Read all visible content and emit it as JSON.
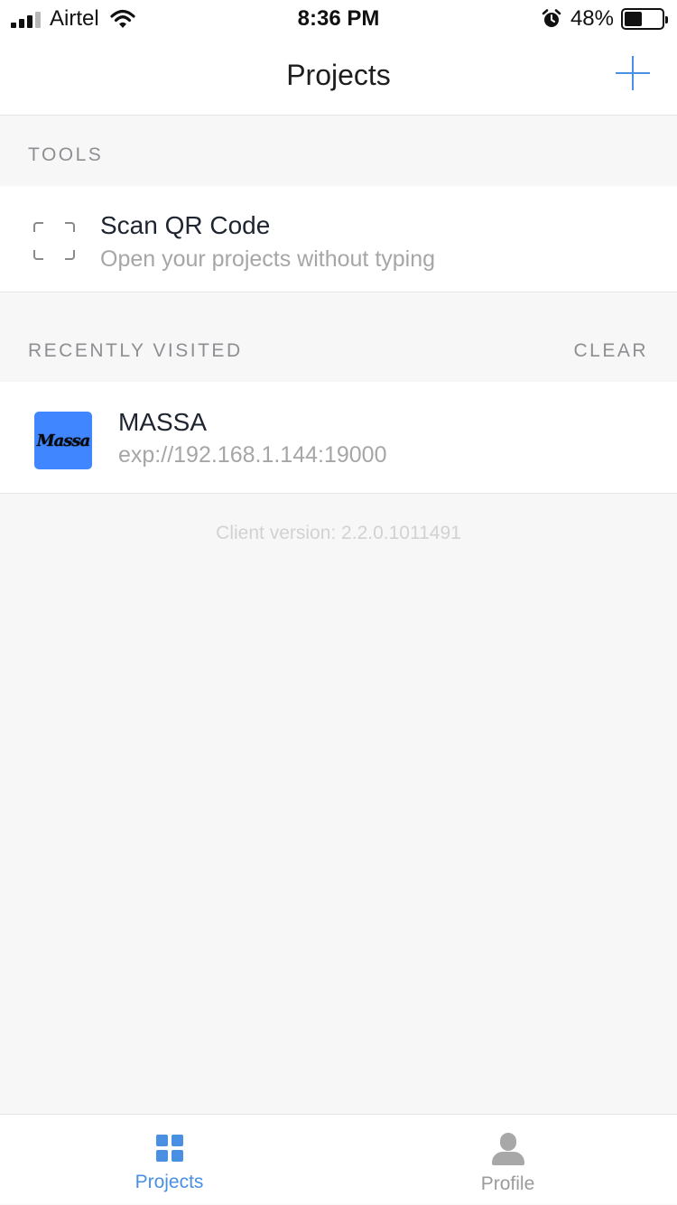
{
  "status_bar": {
    "carrier": "Airtel",
    "time": "8:36 PM",
    "battery_percent_label": "48%",
    "battery_level": 0.48,
    "icons": [
      "signal-icon",
      "wifi-icon",
      "alarm-icon",
      "battery-icon"
    ]
  },
  "nav": {
    "title": "Projects",
    "add_icon": "plus-icon",
    "accent_color": "#4a90e2"
  },
  "tools": {
    "header": "TOOLS",
    "scan": {
      "title": "Scan QR Code",
      "subtitle": "Open your projects without typing",
      "icon": "qr-scan-icon"
    }
  },
  "recent": {
    "header": "RECENTLY VISITED",
    "clear_label": "CLEAR",
    "items": [
      {
        "name": "MASSA",
        "url": "exp://192.168.1.144:19000",
        "icon_text": "Massa",
        "icon_color": "#3f86ff"
      }
    ]
  },
  "footer": {
    "client_version": "Client version: 2.2.0.1011491"
  },
  "tabbar": {
    "tabs": [
      {
        "label": "Projects",
        "icon": "grid-icon",
        "active": true
      },
      {
        "label": "Profile",
        "icon": "person-icon",
        "active": false
      }
    ]
  }
}
